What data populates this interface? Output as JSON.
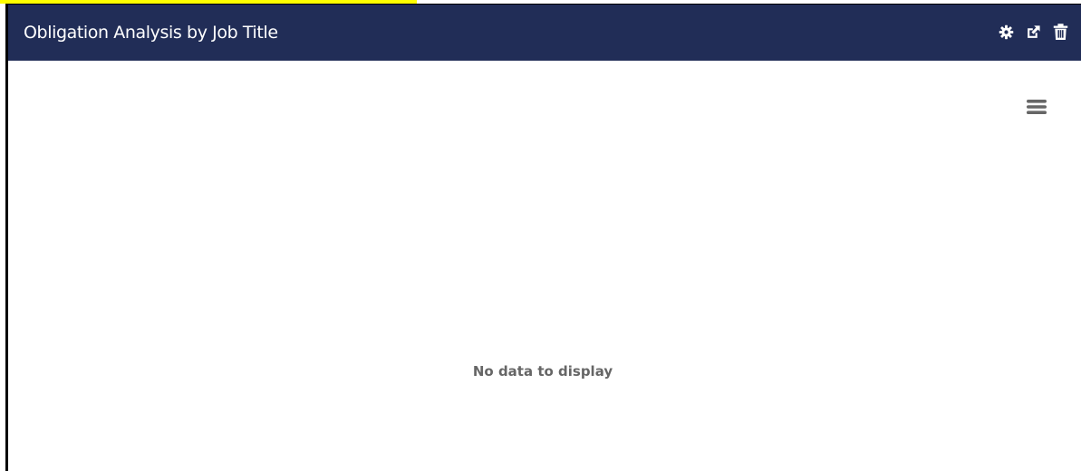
{
  "widget": {
    "title": "Obligation Analysis by Job Title",
    "header_bg": "#212d57",
    "actions": [
      {
        "icon": "gear-icon"
      },
      {
        "icon": "external-link-icon"
      },
      {
        "icon": "trash-icon"
      }
    ]
  },
  "chart": {
    "menu_icon": "hamburger-menu-icon",
    "empty_message": "No data to display",
    "message_color": "#666666"
  }
}
